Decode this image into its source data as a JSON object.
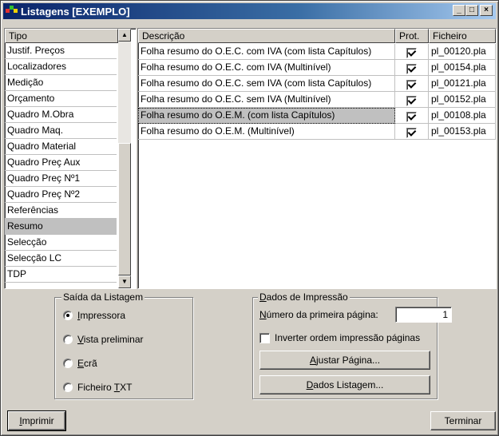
{
  "window": {
    "title": "Listagens [EXEMPLO]",
    "buttons": {
      "minimize": "_",
      "maximize": "□",
      "close": "×"
    }
  },
  "tipo_list": {
    "header": "Tipo",
    "items": [
      {
        "label": "Justif. Preços"
      },
      {
        "label": "Localizadores"
      },
      {
        "label": "Medição"
      },
      {
        "label": "Orçamento"
      },
      {
        "label": "Quadro M.Obra"
      },
      {
        "label": "Quadro Maq."
      },
      {
        "label": "Quadro Material"
      },
      {
        "label": "Quadro Preç Aux"
      },
      {
        "label": "Quadro Preç Nº1"
      },
      {
        "label": "Quadro Preç Nº2"
      },
      {
        "label": "Referências"
      },
      {
        "label": "Resumo"
      },
      {
        "label": "Selecção"
      },
      {
        "label": "Selecção LC"
      },
      {
        "label": "TDP"
      }
    ],
    "selected": "Resumo",
    "scroll_up_icon": "triangle-up",
    "scroll_down_icon": "triangle-down"
  },
  "listings_table": {
    "columns": [
      "Descrição",
      "Prot.",
      "Ficheiro"
    ],
    "rows": [
      {
        "descricao": "Folha resumo do O.E.C. com IVA (com lista Capítulos)",
        "prot": true,
        "ficheiro": "pl_00120.pla"
      },
      {
        "descricao": "Folha resumo do O.E.C. com IVA (Multinível)",
        "prot": true,
        "ficheiro": "pl_00154.pla"
      },
      {
        "descricao": "Folha resumo do O.E.C. sem IVA (com lista Capítulos)",
        "prot": true,
        "ficheiro": "pl_00121.pla"
      },
      {
        "descricao": "Folha resumo do O.E.C. sem IVA (Multinível)",
        "prot": true,
        "ficheiro": "pl_00152.pla"
      },
      {
        "descricao": "Folha resumo do O.E.M. (com lista Capítulos)",
        "prot": true,
        "ficheiro": "pl_00108.pla",
        "selected": true
      },
      {
        "descricao": "Folha resumo do O.E.M. (Multinível)",
        "prot": true,
        "ficheiro": "pl_00153.pla"
      }
    ]
  },
  "output_group": {
    "legend": "Saída da Listagem",
    "options": [
      {
        "label": "Impressora",
        "checked": true
      },
      {
        "label": "Vista preliminar",
        "checked": false
      },
      {
        "label": "Ecrã",
        "checked": false
      },
      {
        "label": "Ficheiro TXT",
        "checked": false
      }
    ]
  },
  "print_group": {
    "legend": "Dados de Impressão",
    "first_page_label": "Número da primeira página:",
    "first_page_value": "1",
    "invert_label": "Inverter ordem impressão páginas",
    "invert_checked": false,
    "adjust_button": "Ajustar Página...",
    "listing_data_button": "Dados Listagem..."
  },
  "footer": {
    "print_button": "Imprimir",
    "finish_button": "Terminar"
  },
  "colors": {
    "face": "#d4d0c8",
    "title_start": "#0a246a",
    "title_end": "#a6caf0",
    "selection": "#c0c0c0"
  }
}
